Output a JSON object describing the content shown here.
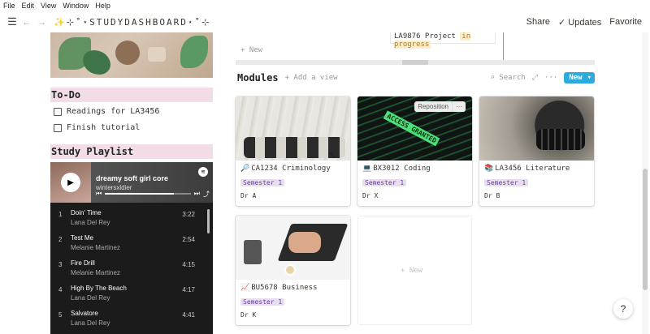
{
  "menubar": {
    "items": [
      "File",
      "Edit",
      "View",
      "Window",
      "Help"
    ]
  },
  "topbar": {
    "title": "✨⊹˚⋆STUDYDASHBOARD⋆˚⊹",
    "share": "Share",
    "updates": "Updates",
    "favorite": "Favorite"
  },
  "todo": {
    "heading": "To-Do",
    "items": [
      {
        "label": "Readings for LA3456",
        "checked": false
      },
      {
        "label": "Finish tutorial",
        "checked": false
      }
    ]
  },
  "playlist": {
    "heading": "Study Playlist",
    "name": "dreamy soft girl core",
    "owner": "wintersxldier",
    "progress": 0.8,
    "tracks": [
      {
        "num": "1",
        "title": "Doin' Time",
        "artist": "Lana Del Rey",
        "duration": "3:22"
      },
      {
        "num": "2",
        "title": "Test Me",
        "artist": "Melanie Martinez",
        "duration": "2:54"
      },
      {
        "num": "3",
        "title": "Fire Drill",
        "artist": "Melanie Martinez",
        "duration": "4:15"
      },
      {
        "num": "4",
        "title": "High By The Beach",
        "artist": "Lana Del Rey",
        "duration": "4:17"
      },
      {
        "num": "5",
        "title": "Salvatore",
        "artist": "Lana Del Rey",
        "duration": "4:41"
      }
    ]
  },
  "prev_table": {
    "row_text": "LA9876 Project",
    "status": "in progress",
    "new_label": "+ New"
  },
  "modules": {
    "title": "Modules",
    "add_view": "+ Add a view",
    "search": "Search",
    "new_button": "New",
    "reposition": "Reposition",
    "new_card": "+ New",
    "cards": [
      {
        "icon": "🔎",
        "code": "CA1234 Criminology",
        "tag": "Semester 1",
        "prof": "Dr A"
      },
      {
        "icon": "💻",
        "code": "BX3012 Coding",
        "tag": "Semester 1",
        "prof": "Dr X"
      },
      {
        "icon": "📚",
        "code": "LA3456 Literature",
        "tag": "Semester 1",
        "prof": "Dr B"
      },
      {
        "icon": "📈",
        "code": "BU5678 Business",
        "tag": "Semester 1",
        "prof": "Dr K"
      }
    ]
  },
  "help": "?"
}
